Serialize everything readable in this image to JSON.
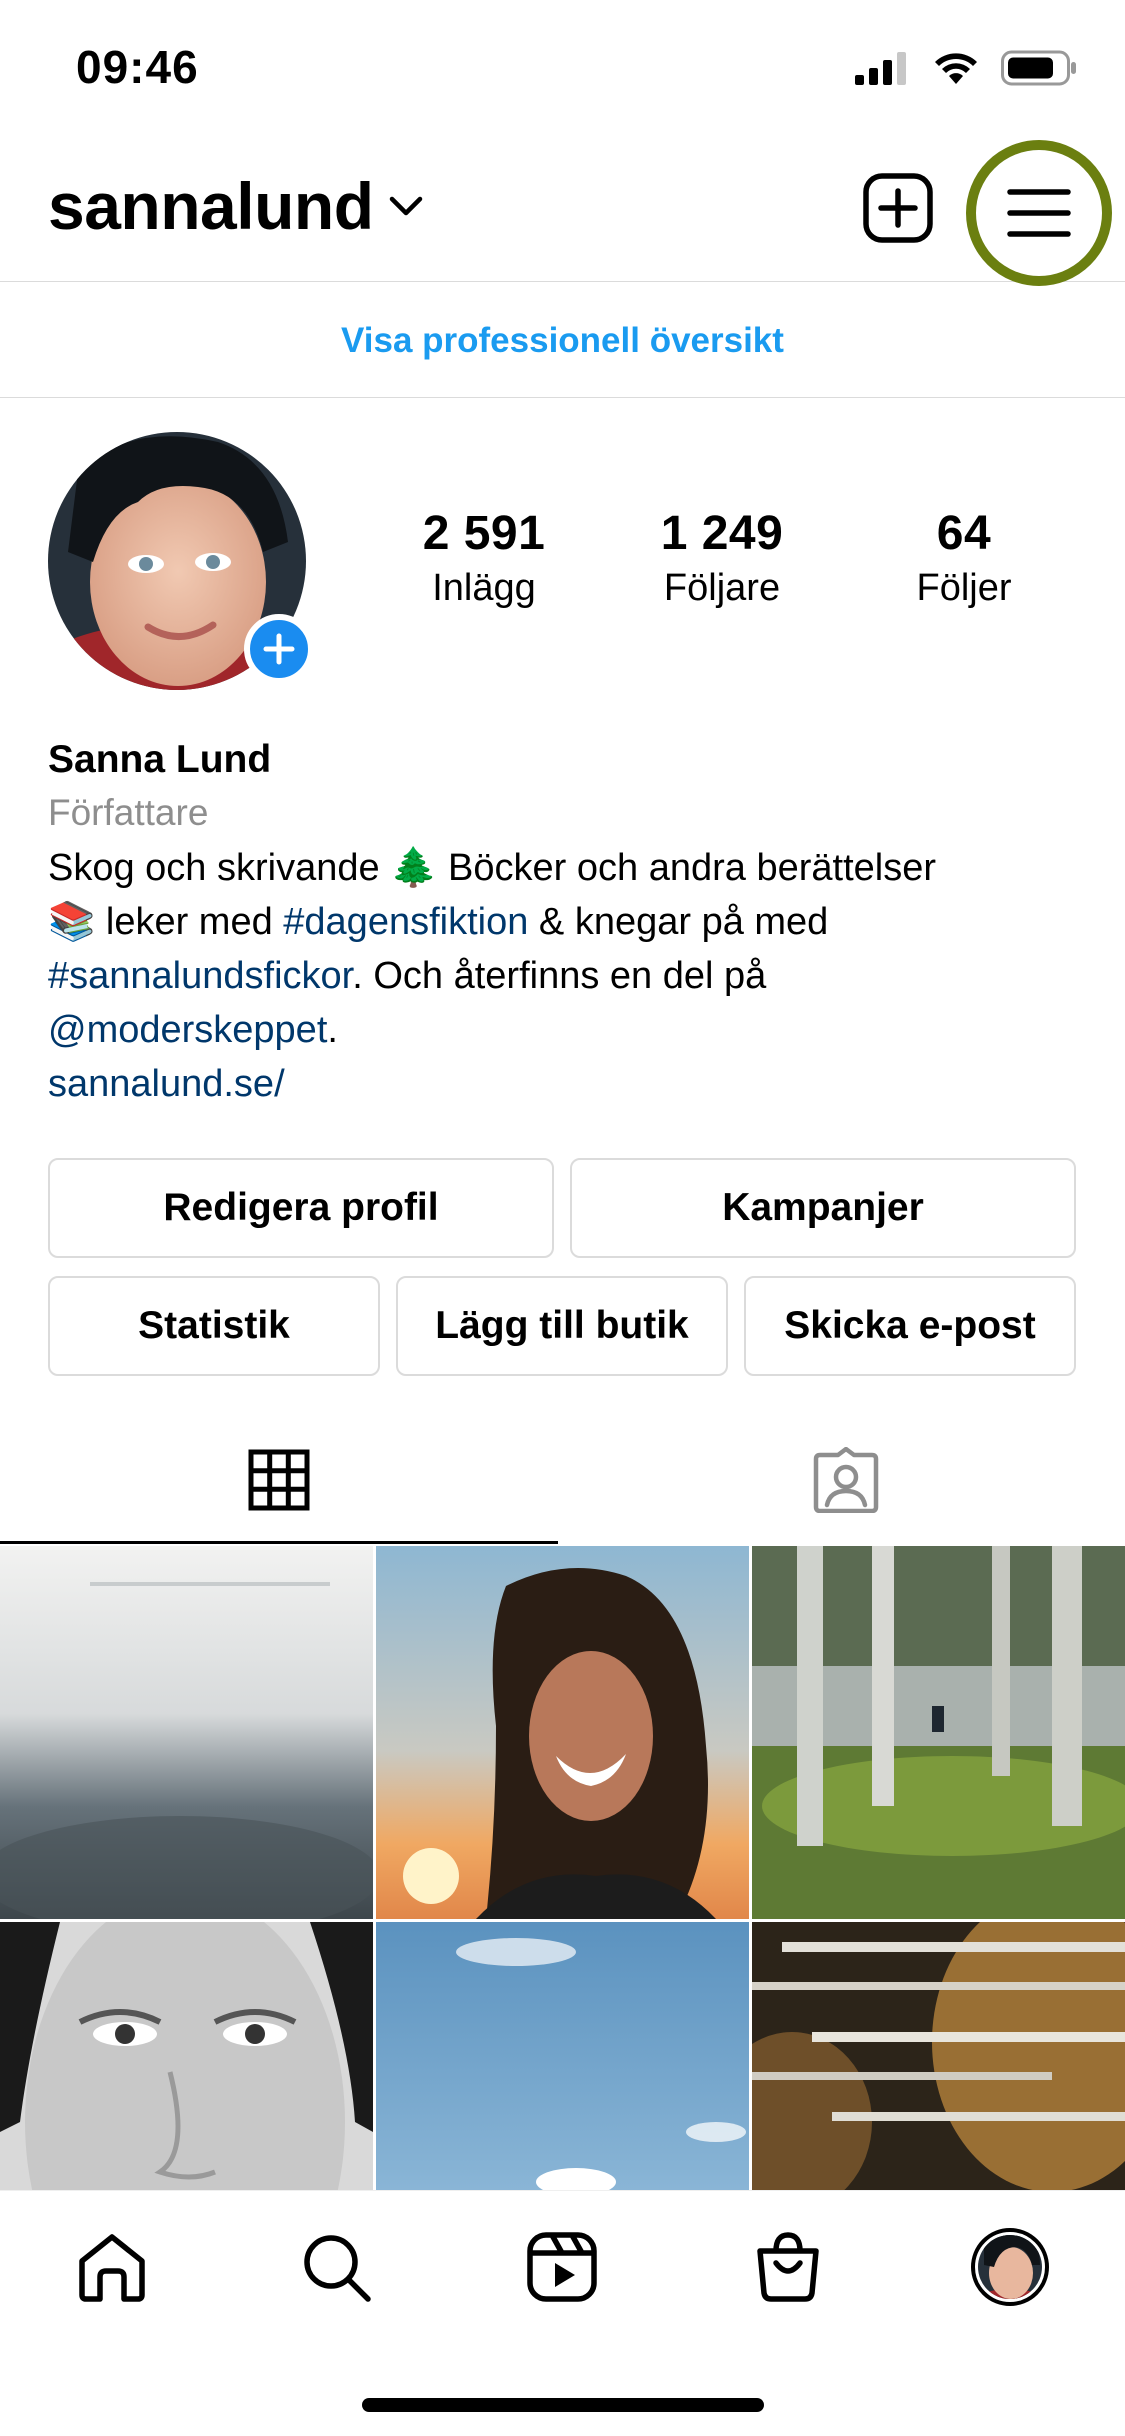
{
  "status_bar": {
    "time": "09:46"
  },
  "header": {
    "username": "sannalund"
  },
  "professional_link": "Visa professionell översikt",
  "stats": [
    {
      "number": "2 591",
      "label": "Inlägg"
    },
    {
      "number": "1 249",
      "label": "Följare"
    },
    {
      "number": "64",
      "label": "Följer"
    }
  ],
  "bio": {
    "name": "Sanna Lund",
    "category": "Författare",
    "line1": "Skog och skrivande 🌲 Böcker och andra berättelser",
    "line2_pre": "📚 leker med ",
    "line2_tag": "#dagensfiktion",
    "line2_post": " & knegar på med",
    "line3_tag": "#sannalundsfickor",
    "line3_post": ". Och återfinns en del på",
    "line4_mention": "@moderskeppet",
    "line4_post": ".",
    "website": "sannalund.se/"
  },
  "buttons": {
    "edit_profile": "Redigera profil",
    "promotions": "Kampanjer",
    "insights": "Statistik",
    "add_shop": "Lägg till butik",
    "email": "Skicka e-post"
  },
  "colors": {
    "link_blue": "#1a9bf0",
    "tag_blue": "#00376b",
    "highlight_ring": "#6b7f10",
    "divider": "#dbdbdb"
  },
  "icons": {
    "create": "plus-square-icon",
    "menu": "hamburger-menu-icon",
    "grid_tab": "grid-icon",
    "tagged_tab": "tagged-person-icon",
    "home": "home-icon",
    "search": "search-icon",
    "reels": "reels-icon",
    "shop": "shopping-bag-icon",
    "profile": "profile-avatar-icon"
  }
}
